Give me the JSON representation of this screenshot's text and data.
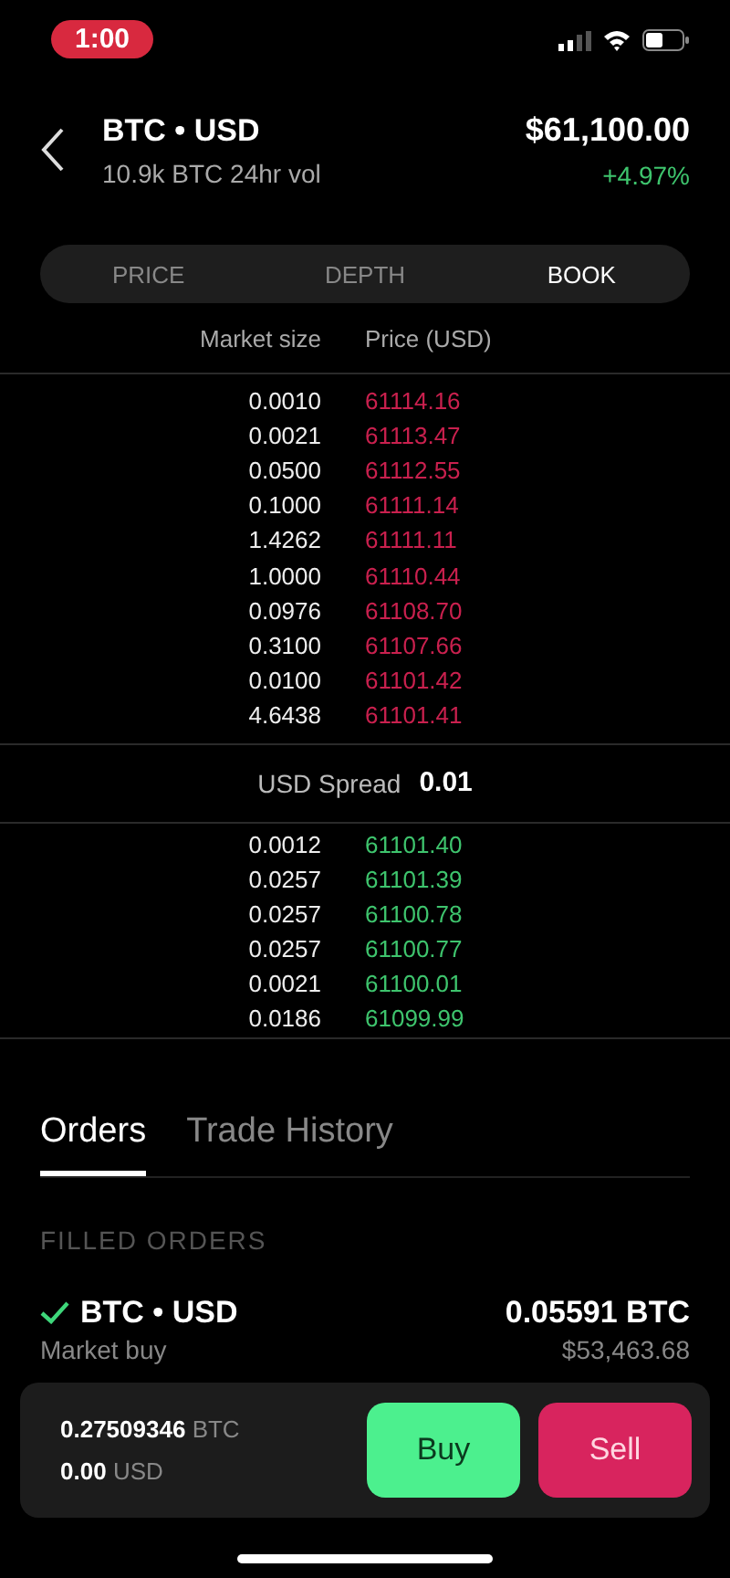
{
  "status_bar": {
    "time": "1:00"
  },
  "header": {
    "pair": "BTC • USD",
    "volume": "10.9k BTC 24hr vol",
    "price": "$61,100.00",
    "change": "+4.97%"
  },
  "tabs": [
    {
      "label": "PRICE",
      "selected": false
    },
    {
      "label": "DEPTH",
      "selected": false
    },
    {
      "label": "BOOK",
      "selected": true
    }
  ],
  "book": {
    "columns": [
      "Market size",
      "Price (USD)"
    ],
    "asks": [
      {
        "size": "0.0010",
        "price": "61114.16"
      },
      {
        "size": "0.0021",
        "price": "61113.47"
      },
      {
        "size": "0.0500",
        "price": "61112.55"
      },
      {
        "size": "0.1000",
        "price": "61111.14"
      },
      {
        "size": "1.4262",
        "price": "61111.11"
      },
      {
        "size": "1.0000",
        "price": "61110.44"
      },
      {
        "size": "0.0976",
        "price": "61108.70"
      },
      {
        "size": "0.3100",
        "price": "61107.66"
      },
      {
        "size": "0.0100",
        "price": "61101.42"
      },
      {
        "size": "4.6438",
        "price": "61101.41"
      }
    ],
    "spread_label": "USD Spread",
    "spread_value": "0.01",
    "bids": [
      {
        "size": "0.0012",
        "price": "61101.40"
      },
      {
        "size": "0.0257",
        "price": "61101.39"
      },
      {
        "size": "0.0257",
        "price": "61100.78"
      },
      {
        "size": "0.0257",
        "price": "61100.77"
      },
      {
        "size": "0.0021",
        "price": "61100.01"
      },
      {
        "size": "0.0186",
        "price": "61099.99"
      }
    ]
  },
  "order_tabs": [
    {
      "label": "Orders",
      "selected": true
    },
    {
      "label": "Trade History",
      "selected": false
    }
  ],
  "section_title": "FILLED ORDERS",
  "orders": [
    {
      "pair": "BTC • USD",
      "filled": true,
      "amount": "0.05591 BTC",
      "type": "Market buy",
      "price": "$53,463.68"
    }
  ],
  "balance": {
    "btc_amount": "0.27509346",
    "btc_unit": "BTC",
    "usd_amount": "0.00",
    "usd_unit": "USD"
  },
  "buttons": [
    {
      "label": "Buy",
      "kind": "buy"
    },
    {
      "label": "Sell",
      "kind": "sell"
    }
  ]
}
